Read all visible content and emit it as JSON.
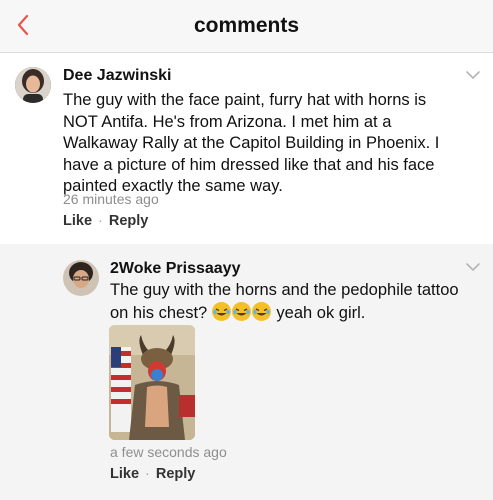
{
  "header": {
    "title": "comments",
    "accent": "#e8554e"
  },
  "comments": [
    {
      "author": "Dee Jazwinski",
      "text": "The guy with the face paint, furry hat with horns is NOT Antifa. He's from Arizona. I met him at a Walkaway Rally at the Capitol Building in Phoenix. I have a picture of him dressed like that and his face painted exactly the same way.",
      "time": "26 minutes ago",
      "like_label": "Like",
      "separator": "·",
      "reply_label": "Reply"
    },
    {
      "author": "2Woke Prissaayy",
      "text_before": "The guy with the horns and the pedophile tattoo on his chest?",
      "emoji": [
        "face-with-tears-of-joy",
        "face-with-tears-of-joy",
        "face-with-tears-of-joy"
      ],
      "text_after": "yeah ok girl.",
      "time": "a few seconds ago",
      "like_label": "Like",
      "separator": "·",
      "reply_label": "Reply"
    }
  ]
}
